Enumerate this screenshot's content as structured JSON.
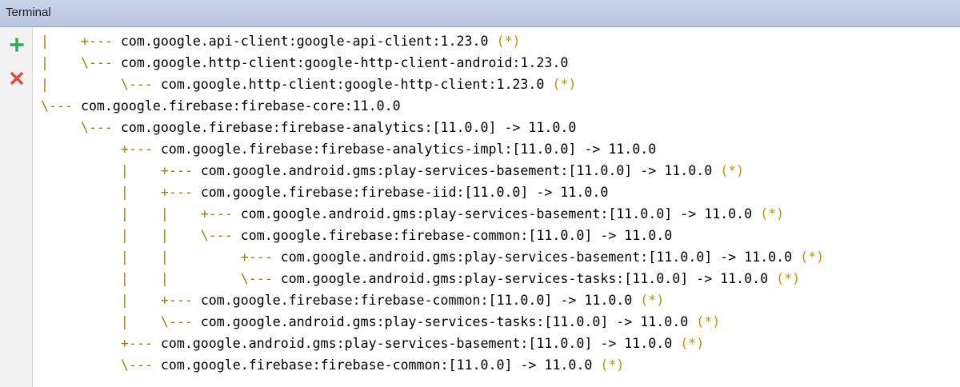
{
  "window": {
    "title": "Terminal"
  },
  "colors": {
    "tree_branch": "#9d7d00",
    "omitted_marker": "#c49300",
    "add_icon": "#2da84d",
    "close_icon": "#e0493c"
  },
  "toolbar": {
    "icons": [
      "plus-icon",
      "close-icon"
    ]
  },
  "terminal": {
    "lines": [
      {
        "prefix": "|    +--- ",
        "text": "com.google.api-client:google-api-client:1.23.0",
        "marker": " (*)"
      },
      {
        "prefix": "|    \\--- ",
        "text": "com.google.http-client:google-http-client-android:1.23.0",
        "marker": ""
      },
      {
        "prefix": "|         \\--- ",
        "text": "com.google.http-client:google-http-client:1.23.0",
        "marker": " (*)"
      },
      {
        "prefix": "\\--- ",
        "text": "com.google.firebase:firebase-core:11.0.0",
        "marker": ""
      },
      {
        "prefix": "     \\--- ",
        "text": "com.google.firebase:firebase-analytics:[11.0.0] -> 11.0.0",
        "marker": ""
      },
      {
        "prefix": "          +--- ",
        "text": "com.google.firebase:firebase-analytics-impl:[11.0.0] -> 11.0.0",
        "marker": ""
      },
      {
        "prefix": "          |    +--- ",
        "text": "com.google.android.gms:play-services-basement:[11.0.0] -> 11.0.0",
        "marker": " (*)"
      },
      {
        "prefix": "          |    +--- ",
        "text": "com.google.firebase:firebase-iid:[11.0.0] -> 11.0.0",
        "marker": ""
      },
      {
        "prefix": "          |    |    +--- ",
        "text": "com.google.android.gms:play-services-basement:[11.0.0] -> 11.0.0",
        "marker": " (*)"
      },
      {
        "prefix": "          |    |    \\--- ",
        "text": "com.google.firebase:firebase-common:[11.0.0] -> 11.0.0",
        "marker": ""
      },
      {
        "prefix": "          |    |         +--- ",
        "text": "com.google.android.gms:play-services-basement:[11.0.0] -> 11.0.0",
        "marker": " (*)"
      },
      {
        "prefix": "          |    |         \\--- ",
        "text": "com.google.android.gms:play-services-tasks:[11.0.0] -> 11.0.0",
        "marker": " (*)"
      },
      {
        "prefix": "          |    +--- ",
        "text": "com.google.firebase:firebase-common:[11.0.0] -> 11.0.0",
        "marker": " (*)"
      },
      {
        "prefix": "          |    \\--- ",
        "text": "com.google.android.gms:play-services-tasks:[11.0.0] -> 11.0.0",
        "marker": " (*)"
      },
      {
        "prefix": "          +--- ",
        "text": "com.google.android.gms:play-services-basement:[11.0.0] -> 11.0.0",
        "marker": " (*)"
      },
      {
        "prefix": "          \\--- ",
        "text": "com.google.firebase:firebase-common:[11.0.0] -> 11.0.0",
        "marker": " (*)"
      }
    ]
  }
}
